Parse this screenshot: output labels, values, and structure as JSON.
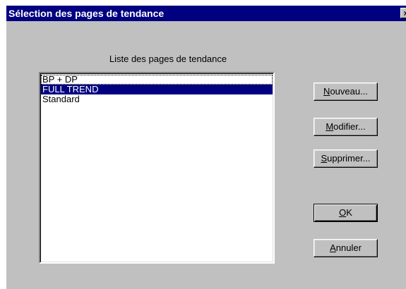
{
  "window": {
    "title": "Sélection des pages de tendance",
    "close_label": "×"
  },
  "list": {
    "label": "Liste des pages de tendance",
    "items": [
      {
        "label": "BP + DP",
        "selected": false,
        "focused": true
      },
      {
        "label": "FULL TREND",
        "selected": true,
        "focused": false
      },
      {
        "label": "Standard",
        "selected": false,
        "focused": false
      }
    ]
  },
  "buttons": {
    "new": {
      "accel": "N",
      "rest": "ouveau..."
    },
    "modify": {
      "accel": "M",
      "rest": "odifier..."
    },
    "delete": {
      "accel": "S",
      "rest": "upprimer..."
    },
    "ok": {
      "accel": "O",
      "rest": "K"
    },
    "cancel": {
      "accel": "A",
      "rest": "nnuler"
    }
  },
  "colors": {
    "titlebar": "#000080",
    "dialog_bg": "#c0c0c0",
    "selection": "#000080"
  }
}
